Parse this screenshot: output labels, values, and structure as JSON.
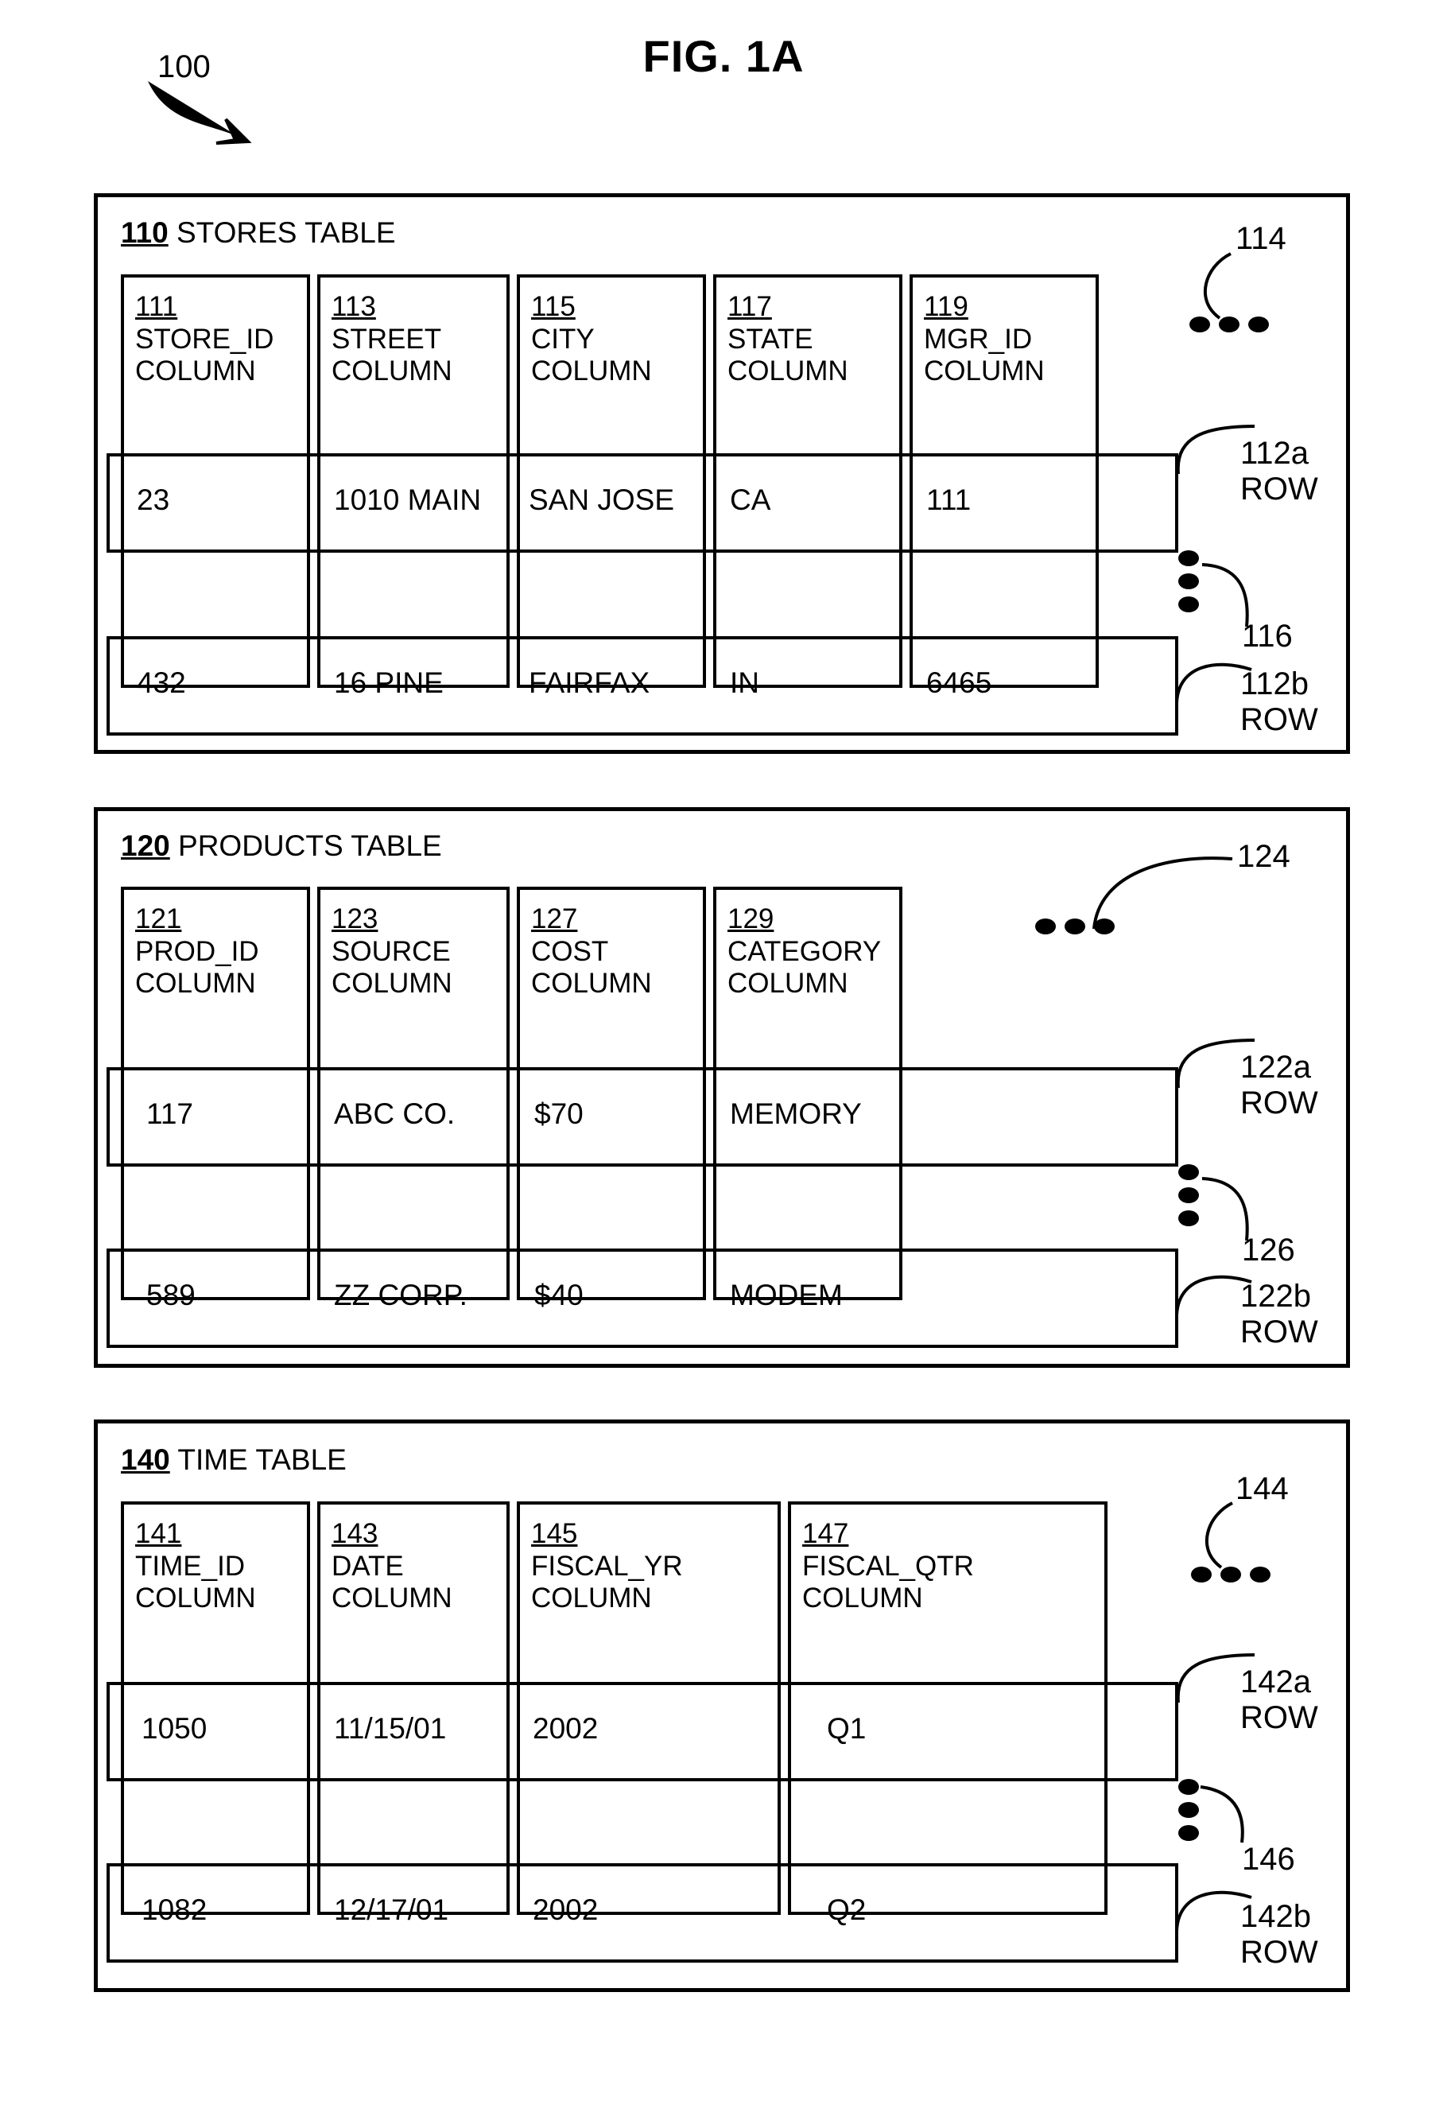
{
  "figure": {
    "title": "FIG. 1A",
    "ref": "100"
  },
  "tables": [
    {
      "id": "stores",
      "caption_num": "110",
      "caption_text": "STORES TABLE",
      "columns": [
        {
          "num": "111",
          "name": "STORE_ID",
          "word": "COLUMN"
        },
        {
          "num": "113",
          "name": "STREET",
          "word": "COLUMN"
        },
        {
          "num": "115",
          "name": "CITY",
          "word": "COLUMN"
        },
        {
          "num": "117",
          "name": "STATE",
          "word": "COLUMN"
        },
        {
          "num": "119",
          "name": "MGR_ID",
          "word": "COLUMN"
        }
      ],
      "rows": [
        {
          "ref": "112a",
          "ref_word": "ROW",
          "cells": [
            "23",
            "1010 MAIN",
            "SAN JOSE",
            "CA",
            "111"
          ]
        },
        {
          "ref": "112b",
          "ref_word": "ROW",
          "cells": [
            "432",
            "16 PINE",
            "FAIRFAX",
            "IN",
            "6465"
          ]
        }
      ],
      "col_ellipsis_ref": "114",
      "row_ellipsis_ref": "116"
    },
    {
      "id": "products",
      "caption_num": "120",
      "caption_text": "PRODUCTS TABLE",
      "columns": [
        {
          "num": "121",
          "name": "PROD_ID",
          "word": "COLUMN"
        },
        {
          "num": "123",
          "name": "SOURCE",
          "word": "COLUMN"
        },
        {
          "num": "127",
          "name": "COST",
          "word": "COLUMN"
        },
        {
          "num": "129",
          "name": "CATEGORY",
          "word": "COLUMN"
        }
      ],
      "rows": [
        {
          "ref": "122a",
          "ref_word": "ROW",
          "cells": [
            "117",
            "ABC CO.",
            "$70",
            "MEMORY"
          ]
        },
        {
          "ref": "122b",
          "ref_word": "ROW",
          "cells": [
            "589",
            "ZZ CORP.",
            "$40",
            "MODEM"
          ]
        }
      ],
      "col_ellipsis_ref": "124",
      "row_ellipsis_ref": "126"
    },
    {
      "id": "time",
      "caption_num": "140",
      "caption_text": "TIME TABLE",
      "columns": [
        {
          "num": "141",
          "name": "TIME_ID",
          "word": "COLUMN"
        },
        {
          "num": "143",
          "name": "DATE",
          "word": "COLUMN"
        },
        {
          "num": "145",
          "name": "FISCAL_YR",
          "word": "COLUMN"
        },
        {
          "num": "147",
          "name": "FISCAL_QTR",
          "word": "COLUMN"
        }
      ],
      "rows": [
        {
          "ref": "142a",
          "ref_word": "ROW",
          "cells": [
            "1050",
            "11/15/01",
            "2002",
            "Q1"
          ]
        },
        {
          "ref": "142b",
          "ref_word": "ROW",
          "cells": [
            "1082",
            "12/17/01",
            "2002",
            "Q2"
          ]
        }
      ],
      "col_ellipsis_ref": "144",
      "row_ellipsis_ref": "146"
    }
  ]
}
